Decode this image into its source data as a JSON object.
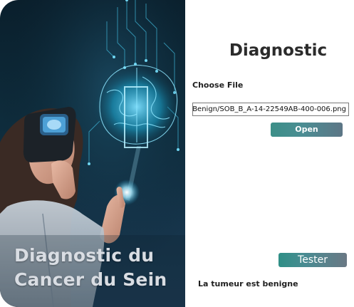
{
  "hero": {
    "title_line1": "Diagnostic du",
    "title_line2": "Cancer du Sein"
  },
  "panel": {
    "title": "Diagnostic",
    "choose_file_label": "Choose File",
    "file_path_value": "Benign/SOB_B_A-14-22549AB-400-006.png",
    "open_button_label": "Open",
    "test_button_label": "Tester",
    "result_text": "La tumeur est benigne"
  },
  "colors": {
    "button_gradient_start": "#3c8f88",
    "button_gradient_end": "#5d7686",
    "hero_background": "#0e2c3c"
  }
}
